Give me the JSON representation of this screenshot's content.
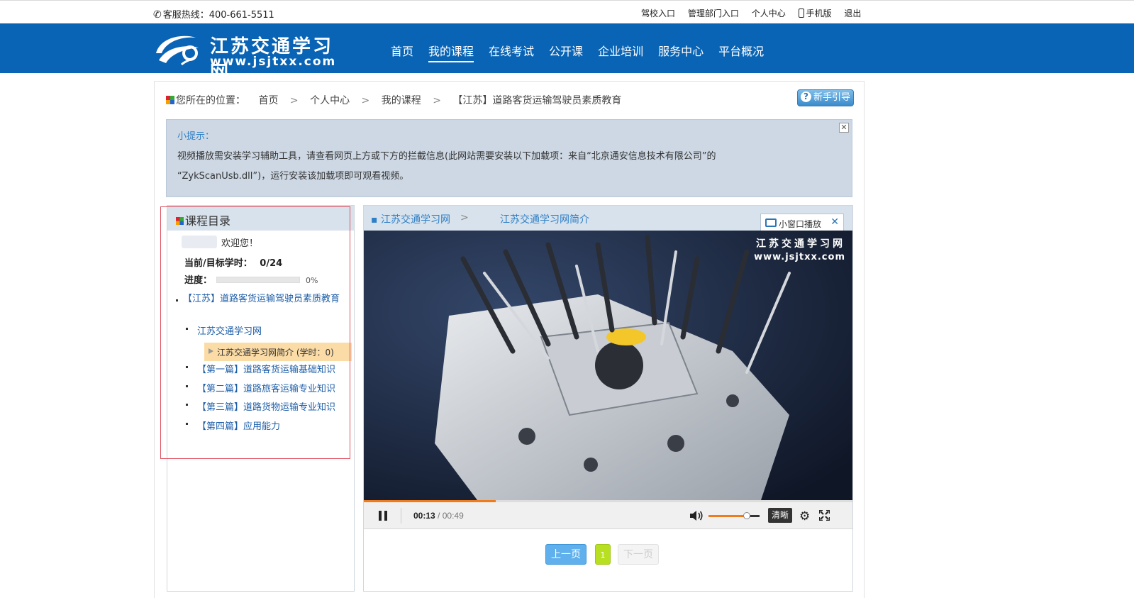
{
  "topbar": {
    "hotline": "客服热线：400-661-5511",
    "links": [
      "驾校入口",
      "管理部门入口",
      "个人中心",
      "手机版",
      "退出"
    ]
  },
  "logo": {
    "title": "江苏交通学习网",
    "url": "www.jsjtxx.com"
  },
  "nav": {
    "items": [
      "首页",
      "我的课程",
      "在线考试",
      "公开课",
      "企业培训",
      "服务中心",
      "平台概况"
    ],
    "active": "我的课程"
  },
  "breadcrumb": {
    "prefix": "您所在的位置：",
    "items": [
      "首页",
      "个人中心",
      "我的课程",
      "【江苏】道路客货运输驾驶员素质教育"
    ],
    "sep": ">"
  },
  "guide_button": "新手引导",
  "tip": {
    "title": "小提示：",
    "line1": "视频播放需安装学习辅助工具，请查看网页上方或下方的拦截信息(此网站需要安装以下加载项：来自“北京通安信息技术有限公司”的",
    "line2": "“ZykScanUsb.dll”)，运行安装该加载项即可观看视频。",
    "close": "✕"
  },
  "sidebar": {
    "title": "课程目录",
    "welcome": "欢迎您！",
    "hours_label": "当前/目标学时：",
    "hours_value": "0/24",
    "progress_label": "进度：",
    "progress_pct": "0%",
    "progress_fraction": 0,
    "course": "【江苏】道路客货运输驾驶员素质教育",
    "chapters": [
      "江苏交通学习网",
      "【第一篇】道路客货运输基础知识",
      "【第二篇】道路旅客运输专业知识",
      "【第三篇】道路货物运输专业知识",
      "【第四篇】应用能力"
    ],
    "current_lesson": "江苏交通学习网简介 (学时：0)"
  },
  "player": {
    "crumb1": "江苏交通学习网",
    "crumb_sep": ">",
    "crumb2": "江苏交通学习网简介",
    "mini_window": "小窗口播放",
    "mini_close": "✕",
    "watermark_title": "江苏交通学习网",
    "watermark_url": "www.jsjtxx.com",
    "time_current": "00:13",
    "time_sep": " / ",
    "time_total": "00:49",
    "seek_fraction": 0.27,
    "volume_fraction": 0.75,
    "quality": "清晰"
  },
  "pager": {
    "prev": "上一页",
    "page": "1",
    "next": "下一页"
  },
  "colors": {
    "nav_blue": "#0a64b5",
    "link_blue": "#1f5fa8",
    "progress_orange": "#f07b1a",
    "current_lesson_bg": "#fbdca6"
  }
}
